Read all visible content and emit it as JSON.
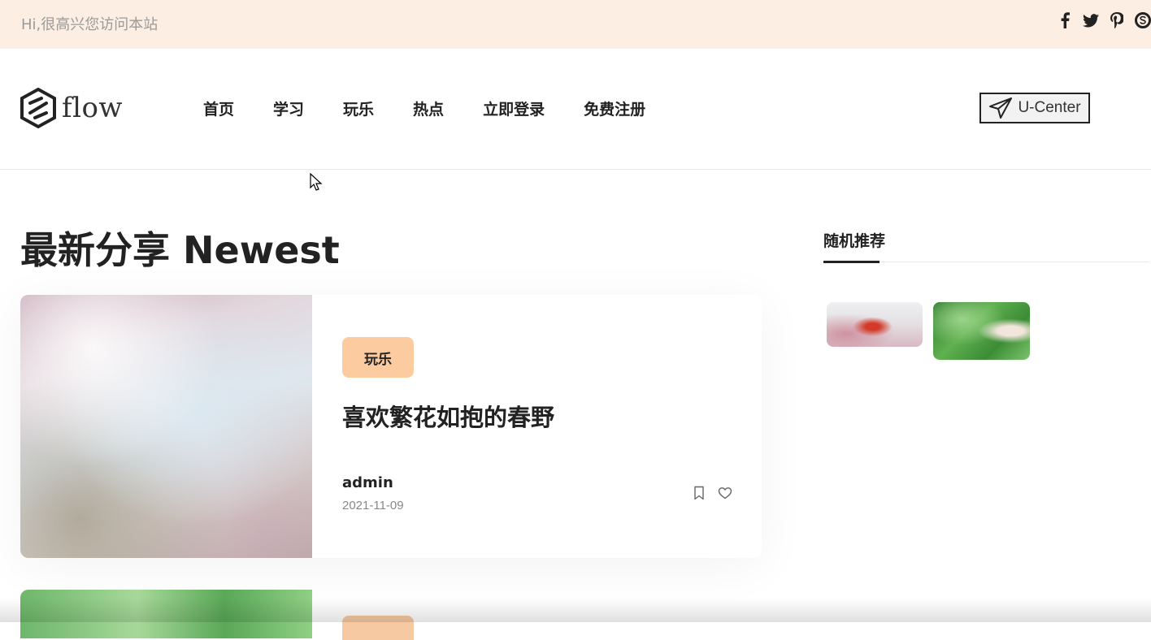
{
  "topbar": {
    "greeting": "Hi,很高兴您访问本站",
    "social": [
      {
        "icon": "facebook-icon",
        "glyph": "f"
      },
      {
        "icon": "twitter-icon",
        "glyph": "t"
      },
      {
        "icon": "pinterest-icon",
        "glyph": "p"
      },
      {
        "icon": "skype-icon",
        "glyph": "s"
      }
    ]
  },
  "header": {
    "logo_text": "flow",
    "nav": [
      "首页",
      "学习",
      "玩乐",
      "热点",
      "立即登录",
      "免费注册"
    ],
    "ucenter_label": "U-Center"
  },
  "main": {
    "section_title": "最新分享 Newest",
    "posts": [
      {
        "tag": "玩乐",
        "title": "喜欢繁花如抱的春野",
        "author": "admin",
        "date": "2021-11-09"
      }
    ]
  },
  "sidebar": {
    "title": "随机推荐"
  },
  "colors": {
    "topbar_bg": "#fdeee4",
    "tag_bg": "#fccca0",
    "text_dark": "#222222"
  }
}
